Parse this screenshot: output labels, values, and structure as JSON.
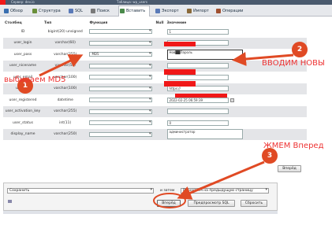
{
  "breadcrumbs": [
    "Сервер: dev.io",
    "Таблица: wp_users"
  ],
  "tabs": [
    {
      "label": "Обзор",
      "icon": "browse-icon",
      "color": "#3a6fb0"
    },
    {
      "label": "Структура",
      "icon": "structure-icon",
      "color": "#6a8f3a"
    },
    {
      "label": "SQL",
      "icon": "sql-icon",
      "color": "#5a7ab8"
    },
    {
      "label": "Поиск",
      "icon": "search-icon",
      "color": "#7a7a7a"
    },
    {
      "label": "Вставить",
      "icon": "insert-icon",
      "color": "#4a8a4a"
    },
    {
      "label": "Экспорт",
      "icon": "export-icon",
      "color": "#5a7ab8"
    },
    {
      "label": "Импорт",
      "icon": "import-icon",
      "color": "#8a6a3a"
    },
    {
      "label": "Операции",
      "icon": "operations-icon",
      "color": "#a05030"
    }
  ],
  "grid": {
    "headers": {
      "column": "Столбец",
      "type": "Тип",
      "function": "Функция",
      "null": "Null",
      "value": "Значение"
    },
    "rows": [
      {
        "column": "ID",
        "type": "bigint(20) unsigned",
        "function": "",
        "value": "1"
      },
      {
        "column": "user_login",
        "type": "varchar(60)",
        "function": "",
        "value": ""
      },
      {
        "column": "user_pass",
        "type": "varchar(255)",
        "function": "MD5",
        "value": "Нов██Пароль"
      },
      {
        "column": "user_nicename",
        "type": "varchar(50)",
        "function": "",
        "value": ""
      },
      {
        "column": "user_email",
        "type": "varchar(100)",
        "function": "",
        "value": ""
      },
      {
        "column": "user_url",
        "type": "varchar(100)",
        "function": "",
        "value": "https://"
      },
      {
        "column": "user_registered",
        "type": "datetime",
        "function": "",
        "value": "2022-02-25 06:59:39"
      },
      {
        "column": "user_activation_key",
        "type": "varchar(255)",
        "function": "",
        "value": ""
      },
      {
        "column": "user_status",
        "type": "int(11)",
        "function": "",
        "value": "0"
      },
      {
        "column": "display_name",
        "type": "varchar(250)",
        "function": "",
        "value": "администратор"
      }
    ],
    "go_label": "Вперёд"
  },
  "bottom": {
    "action_value": "Сохранить",
    "then_label": "и затем",
    "after_value": "Вернуться на предыдущую страницу",
    "go_label": "Вперёд",
    "preview_label": "Предпросмотр SQL",
    "reset_label": "Сбросить"
  },
  "annotations": {
    "step1": "1",
    "step1_text": "выбираем MD5",
    "step2": "2",
    "step2_text": "ВВОДИМ НОВЫ",
    "step3": "3",
    "step3_text": "ЖМЕМ Вперед"
  },
  "colors": {
    "accent_red": "#f01818",
    "badge": "#e04a24",
    "annotation": "#ee3333"
  }
}
